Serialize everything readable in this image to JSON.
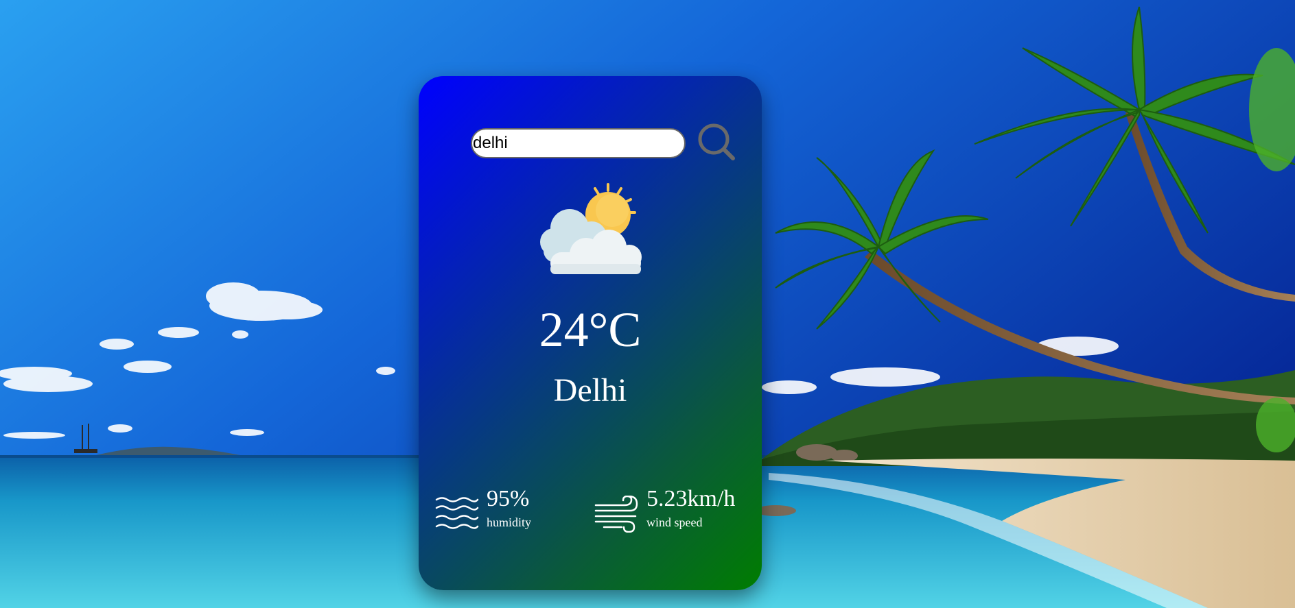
{
  "search": {
    "value": "delhi"
  },
  "weather": {
    "condition_icon": "partly-cloudy-icon",
    "temperature": "24°C",
    "city": "Delhi"
  },
  "humidity": {
    "value": "95%",
    "label": "humidity",
    "icon": "waves-icon"
  },
  "wind": {
    "value": "5.23km/h",
    "label": "wind speed",
    "icon": "wind-icon"
  },
  "colors": {
    "card_gradient_start": "#0000ff",
    "card_gradient_end": "#007d00",
    "text": "#ffffff",
    "sun": "#f9c74f"
  },
  "background": {
    "scene": "tropical beach with palm trees"
  }
}
